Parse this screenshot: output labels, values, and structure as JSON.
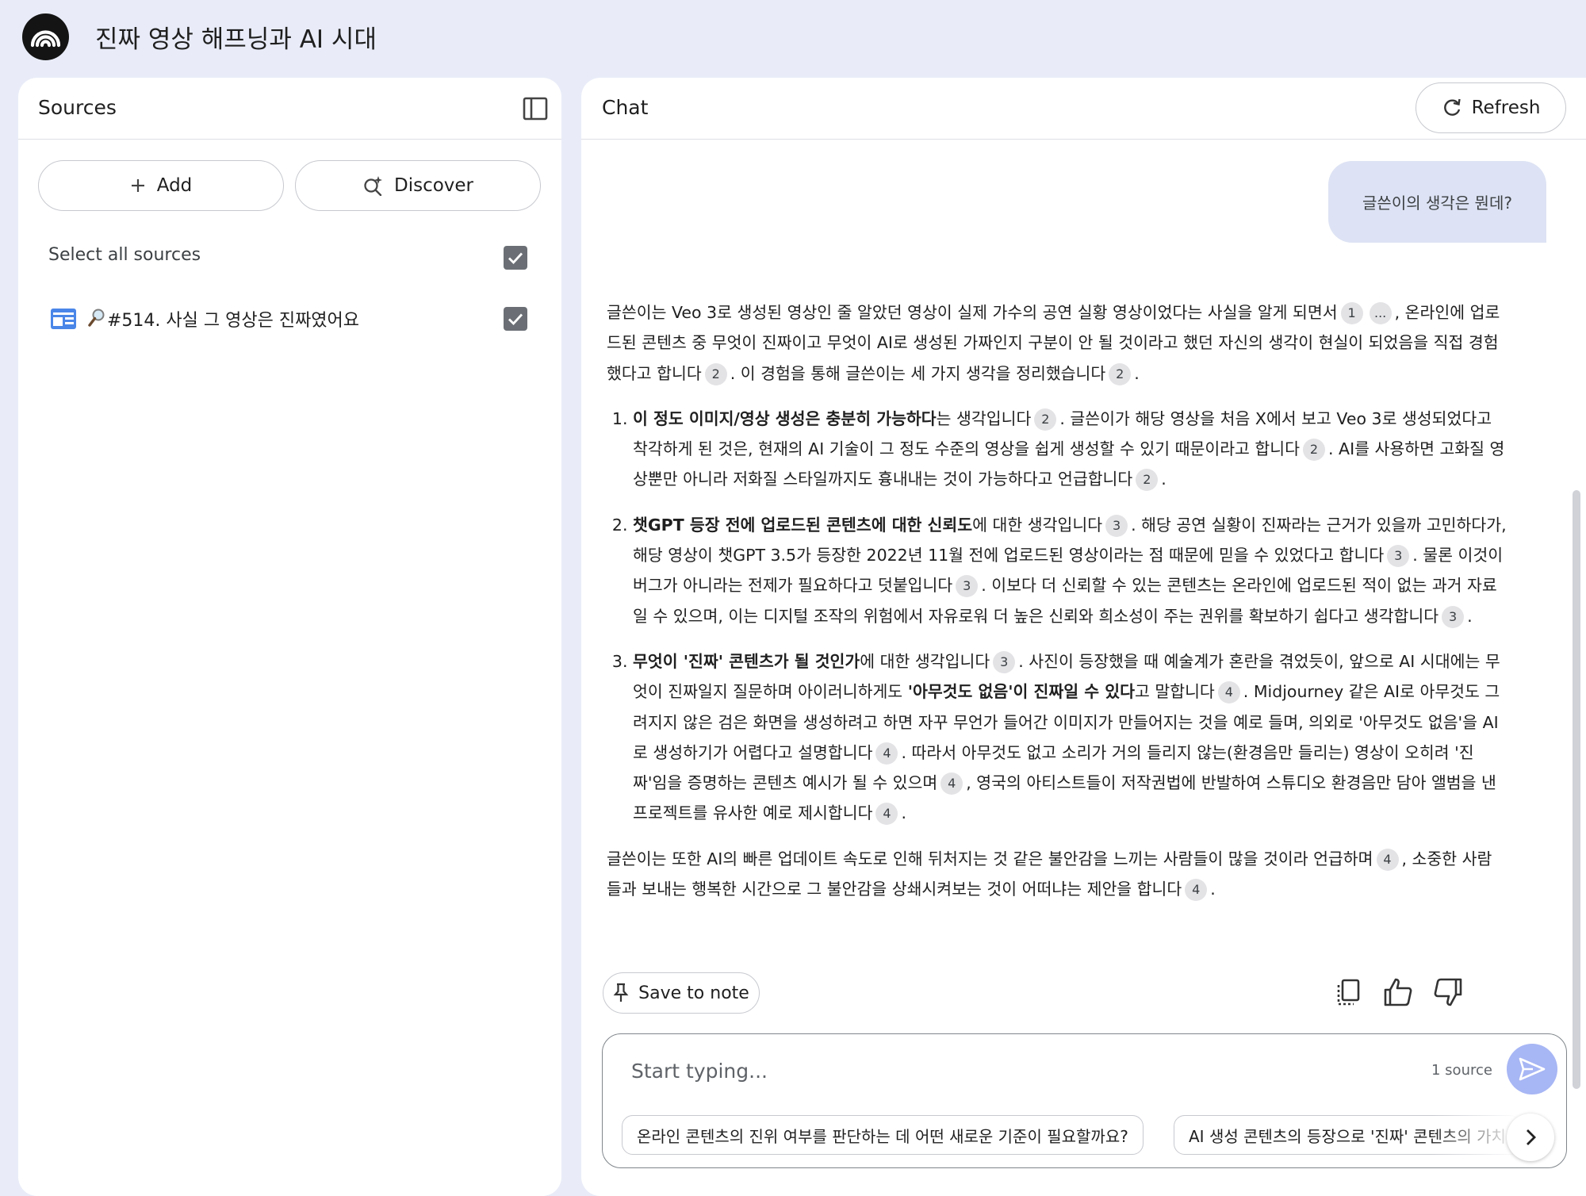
{
  "app": {
    "title": "진짜 영상 해프닝과 AI 시대"
  },
  "sources": {
    "title": "Sources",
    "add_label": "Add",
    "discover_label": "Discover",
    "select_all_label": "Select all sources",
    "select_all_checked": true,
    "items": [
      {
        "label": "#514. 사실 그 영상은 진짜였어요",
        "checked": true
      }
    ]
  },
  "chat": {
    "title": "Chat",
    "refresh_label": "Refresh",
    "user_message": "글쓴이의 생각은 뭔데?",
    "answer": {
      "intro": {
        "t1": "글쓴이는 Veo 3로 생성된 영상인 줄 알았던 영상이 실제 가수의 공연 실황 영상이었다는 사실을 알게 되면서",
        "c1": "1",
        "c2": "...",
        "t2": ", 온라인에 업로드된 콘텐츠 중 무엇이 진짜이고 무엇이 AI로 생성된 가짜인지 구분이 안 될 것이라고 했던 자신의 생각이 현실이 되었음을 직접 경험했다고 합니다",
        "c3": "2",
        "t3": ". 이 경험을 통해 글쓴이는 세 가지 생각을 정리했습니다",
        "c4": "2",
        "t4": "."
      },
      "item1": {
        "bold": "이 정도 이미지/영상 생성은 충분히 가능하다",
        "t1": "는 생각입니다",
        "c1": "2",
        "t2": ". 글쓴이가 해당 영상을 처음 X에서 보고 Veo 3로 생성되었다고 착각하게 된 것은, 현재의 AI 기술이 그 정도 수준의 영상을 쉽게 생성할 수 있기 때문이라고 합니다",
        "c2": "2",
        "t3": ". AI를 사용하면 고화질 영상뿐만 아니라 저화질 스타일까지도 흉내내는 것이 가능하다고 언급합니다",
        "c3": "2",
        "t4": "."
      },
      "item2": {
        "bold": "챗GPT 등장 전에 업로드된 콘텐츠에 대한 신뢰도",
        "t1": "에 대한 생각입니다",
        "c1": "3",
        "t2": ". 해당 공연 실황이 진짜라는 근거가 있을까 고민하다가, 해당 영상이 챗GPT 3.5가 등장한 2022년 11월 전에 업로드된 영상이라는 점 때문에 믿을 수 있었다고 합니다",
        "c2": "3",
        "t3": ". 물론 이것이 버그가 아니라는 전제가 필요하다고 덧붙입니다",
        "c3": "3",
        "t4": ". 이보다 더 신뢰할 수 있는 콘텐츠는 온라인에 업로드된 적이 없는 과거 자료일 수 있으며, 이는 디지털 조작의 위험에서 자유로워 더 높은 신뢰와 희소성이 주는 권위를 확보하기 쉽다고 생각합니다",
        "c4": "3",
        "t5": "."
      },
      "item3": {
        "bold": "무엇이 '진짜' 콘텐츠가 될 것인가",
        "t1": "에 대한 생각입니다",
        "c1": "3",
        "t2": ". 사진이 등장했을 때 예술계가 혼란을 겪었듯이, 앞으로 AI 시대에는 무엇이 진짜일지 질문하며 아이러니하게도 ",
        "bold2": "'아무것도 없음'이 진짜일 수 있다",
        "t3": "고 말합니다",
        "c2": "4",
        "t4": ". Midjourney 같은 AI로 아무것도 그려지지 않은 검은 화면을 생성하려고 하면 자꾸 무언가 들어간 이미지가 만들어지는 것을 예로 들며, 의외로 '아무것도 없음'을 AI로 생성하기가 어렵다고 설명합니다",
        "c3": "4",
        "t5": ". 따라서 아무것도 없고 소리가 거의 들리지 않는(환경음만 들리는) 영상이 오히려 '진짜'임을 증명하는 콘텐츠 예시가 될 수 있으며",
        "c4": "4",
        "t6": ", 영국의 아티스트들이 저작권법에 반발하여 스튜디오 환경음만 담아 앨범을 낸 프로젝트를 유사한 예로 제시합니다",
        "c5": "4",
        "t7": "."
      },
      "outro": {
        "t1": "글쓴이는 또한 AI의 빠른 업데이트 속도로 인해 뒤처지는 것 같은 불안감을 느끼는 사람들이 많을 것이라 언급하며",
        "c1": "4",
        "t2": ", 소중한 사람들과 보내는 행복한 시간으로 그 불안감을 상쇄시켜보는 것이 어떠냐는 제안을 합니다",
        "c2": "4",
        "t3": "."
      }
    },
    "save_to_note_label": "Save to note",
    "composer": {
      "placeholder": "Start typing...",
      "source_count": "1 source"
    },
    "suggestions": [
      "온라인 콘텐츠의 진위 여부를 판단하는 데 어떤 새로운 기준이 필요할까요?",
      "AI 생성 콘텐츠의 등장으로 '진짜' 콘텐츠의 가치"
    ]
  },
  "colors": {
    "page_bg": "#e9ecf8",
    "panel_bg": "#ffffff",
    "user_bubble": "#dde3f4",
    "send_button": "#a7b6f4",
    "citation_chip": "#e3e3e6",
    "source_icon": "#4a86e8"
  },
  "icons": {
    "logo": "notebooklm-logo-icon",
    "collapse": "sidebar-toggle-icon",
    "add": "plus-icon",
    "discover": "sparkle-search-icon",
    "refresh": "refresh-icon",
    "save_note": "pin-icon",
    "copy": "copy-icon",
    "thumb_up": "thumbs-up-icon",
    "thumb_down": "thumbs-down-icon",
    "send": "send-icon",
    "next": "chevron-right-icon"
  }
}
